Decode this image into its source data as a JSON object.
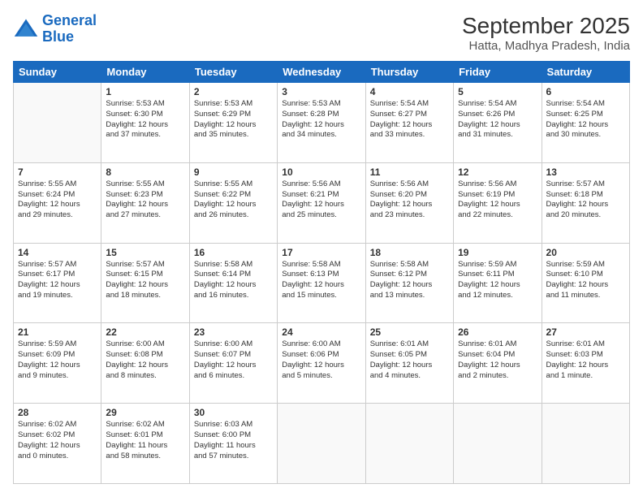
{
  "header": {
    "logo_line1": "General",
    "logo_line2": "Blue",
    "title": "September 2025",
    "subtitle": "Hatta, Madhya Pradesh, India"
  },
  "weekdays": [
    "Sunday",
    "Monday",
    "Tuesday",
    "Wednesday",
    "Thursday",
    "Friday",
    "Saturday"
  ],
  "weeks": [
    [
      {
        "day": "",
        "info": ""
      },
      {
        "day": "1",
        "info": "Sunrise: 5:53 AM\nSunset: 6:30 PM\nDaylight: 12 hours\nand 37 minutes."
      },
      {
        "day": "2",
        "info": "Sunrise: 5:53 AM\nSunset: 6:29 PM\nDaylight: 12 hours\nand 35 minutes."
      },
      {
        "day": "3",
        "info": "Sunrise: 5:53 AM\nSunset: 6:28 PM\nDaylight: 12 hours\nand 34 minutes."
      },
      {
        "day": "4",
        "info": "Sunrise: 5:54 AM\nSunset: 6:27 PM\nDaylight: 12 hours\nand 33 minutes."
      },
      {
        "day": "5",
        "info": "Sunrise: 5:54 AM\nSunset: 6:26 PM\nDaylight: 12 hours\nand 31 minutes."
      },
      {
        "day": "6",
        "info": "Sunrise: 5:54 AM\nSunset: 6:25 PM\nDaylight: 12 hours\nand 30 minutes."
      }
    ],
    [
      {
        "day": "7",
        "info": "Sunrise: 5:55 AM\nSunset: 6:24 PM\nDaylight: 12 hours\nand 29 minutes."
      },
      {
        "day": "8",
        "info": "Sunrise: 5:55 AM\nSunset: 6:23 PM\nDaylight: 12 hours\nand 27 minutes."
      },
      {
        "day": "9",
        "info": "Sunrise: 5:55 AM\nSunset: 6:22 PM\nDaylight: 12 hours\nand 26 minutes."
      },
      {
        "day": "10",
        "info": "Sunrise: 5:56 AM\nSunset: 6:21 PM\nDaylight: 12 hours\nand 25 minutes."
      },
      {
        "day": "11",
        "info": "Sunrise: 5:56 AM\nSunset: 6:20 PM\nDaylight: 12 hours\nand 23 minutes."
      },
      {
        "day": "12",
        "info": "Sunrise: 5:56 AM\nSunset: 6:19 PM\nDaylight: 12 hours\nand 22 minutes."
      },
      {
        "day": "13",
        "info": "Sunrise: 5:57 AM\nSunset: 6:18 PM\nDaylight: 12 hours\nand 20 minutes."
      }
    ],
    [
      {
        "day": "14",
        "info": "Sunrise: 5:57 AM\nSunset: 6:17 PM\nDaylight: 12 hours\nand 19 minutes."
      },
      {
        "day": "15",
        "info": "Sunrise: 5:57 AM\nSunset: 6:15 PM\nDaylight: 12 hours\nand 18 minutes."
      },
      {
        "day": "16",
        "info": "Sunrise: 5:58 AM\nSunset: 6:14 PM\nDaylight: 12 hours\nand 16 minutes."
      },
      {
        "day": "17",
        "info": "Sunrise: 5:58 AM\nSunset: 6:13 PM\nDaylight: 12 hours\nand 15 minutes."
      },
      {
        "day": "18",
        "info": "Sunrise: 5:58 AM\nSunset: 6:12 PM\nDaylight: 12 hours\nand 13 minutes."
      },
      {
        "day": "19",
        "info": "Sunrise: 5:59 AM\nSunset: 6:11 PM\nDaylight: 12 hours\nand 12 minutes."
      },
      {
        "day": "20",
        "info": "Sunrise: 5:59 AM\nSunset: 6:10 PM\nDaylight: 12 hours\nand 11 minutes."
      }
    ],
    [
      {
        "day": "21",
        "info": "Sunrise: 5:59 AM\nSunset: 6:09 PM\nDaylight: 12 hours\nand 9 minutes."
      },
      {
        "day": "22",
        "info": "Sunrise: 6:00 AM\nSunset: 6:08 PM\nDaylight: 12 hours\nand 8 minutes."
      },
      {
        "day": "23",
        "info": "Sunrise: 6:00 AM\nSunset: 6:07 PM\nDaylight: 12 hours\nand 6 minutes."
      },
      {
        "day": "24",
        "info": "Sunrise: 6:00 AM\nSunset: 6:06 PM\nDaylight: 12 hours\nand 5 minutes."
      },
      {
        "day": "25",
        "info": "Sunrise: 6:01 AM\nSunset: 6:05 PM\nDaylight: 12 hours\nand 4 minutes."
      },
      {
        "day": "26",
        "info": "Sunrise: 6:01 AM\nSunset: 6:04 PM\nDaylight: 12 hours\nand 2 minutes."
      },
      {
        "day": "27",
        "info": "Sunrise: 6:01 AM\nSunset: 6:03 PM\nDaylight: 12 hours\nand 1 minute."
      }
    ],
    [
      {
        "day": "28",
        "info": "Sunrise: 6:02 AM\nSunset: 6:02 PM\nDaylight: 12 hours\nand 0 minutes."
      },
      {
        "day": "29",
        "info": "Sunrise: 6:02 AM\nSunset: 6:01 PM\nDaylight: 11 hours\nand 58 minutes."
      },
      {
        "day": "30",
        "info": "Sunrise: 6:03 AM\nSunset: 6:00 PM\nDaylight: 11 hours\nand 57 minutes."
      },
      {
        "day": "",
        "info": ""
      },
      {
        "day": "",
        "info": ""
      },
      {
        "day": "",
        "info": ""
      },
      {
        "day": "",
        "info": ""
      }
    ]
  ]
}
